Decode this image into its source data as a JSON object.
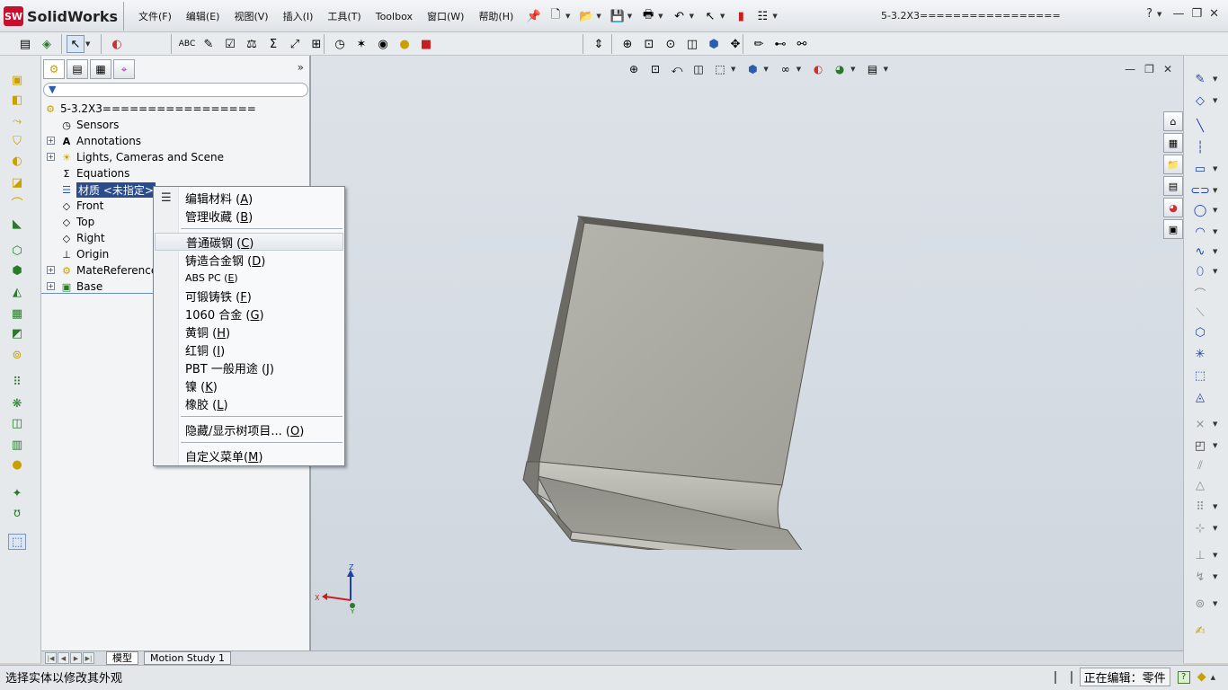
{
  "app": {
    "brand": "SolidWorks",
    "logo_badge": "SW",
    "document_title": "5-3.2X3=================",
    "menus": [
      "文件(F)",
      "编辑(E)",
      "视图(V)",
      "插入(I)",
      "工具(T)",
      "Toolbox",
      "窗口(W)",
      "帮助(H)"
    ],
    "window_controls": {
      "help": "?",
      "minimize": "—",
      "restore": "❐",
      "close": "✕"
    }
  },
  "feature_tree": {
    "tabs": [
      "feature-manager",
      "property-manager",
      "configuration-manager",
      "dimxpert-manager"
    ],
    "expand": "»",
    "root": "5-3.2X3=================",
    "items": [
      {
        "label": "Sensors",
        "expandable": false
      },
      {
        "label": "Annotations",
        "expandable": true
      },
      {
        "label": "Lights, Cameras and Scene",
        "expandable": true
      },
      {
        "label": "Equations",
        "expandable": false
      },
      {
        "label": "材质 <未指定>",
        "expandable": false,
        "selected": true
      },
      {
        "label": "Front",
        "expandable": false
      },
      {
        "label": "Top",
        "expandable": false
      },
      {
        "label": "Right",
        "expandable": false
      },
      {
        "label": "Origin",
        "expandable": false
      },
      {
        "label": "MateReferences",
        "expandable": true
      },
      {
        "label": "Base",
        "expandable": true
      }
    ]
  },
  "context_menu": {
    "items": [
      {
        "text": "编辑材料 ",
        "key": "A"
      },
      {
        "text": "管理收藏 ",
        "key": "B"
      },
      {
        "text": "普通碳钢 ",
        "key": "C",
        "highlighted": true
      },
      {
        "text": "铸造合金钢 ",
        "key": "D"
      },
      {
        "text": "ABS PC ",
        "key": "E"
      },
      {
        "text": "可锻铸铁 ",
        "key": "F"
      },
      {
        "text": "1060 合金 ",
        "key": "G"
      },
      {
        "text": "黄铜 ",
        "key": "H"
      },
      {
        "text": "红铜 ",
        "key": "I"
      },
      {
        "text": "PBT 一般用途 ",
        "key": "J"
      },
      {
        "text": "镍 ",
        "key": "K"
      },
      {
        "text": "橡胶 ",
        "key": "L"
      },
      {
        "text": "隐藏/显示树项目... ",
        "key": "O"
      },
      {
        "text": "自定义菜单",
        "key": "M"
      }
    ]
  },
  "viewport": {
    "triad": {
      "x": "X",
      "y": "Y",
      "z": "Z"
    },
    "controls": {
      "minimize": "—",
      "restore": "❐",
      "close": "✕"
    }
  },
  "bottom_tabs": [
    "模型",
    "Motion Study 1"
  ],
  "status": {
    "message": "选择实体以修改其外观",
    "editing": "正在编辑：零件",
    "help": "?"
  },
  "colors": {
    "selection": "#2a4b8c",
    "viewport_top": "#dde2e8",
    "part_face": "#a8a8a0"
  }
}
